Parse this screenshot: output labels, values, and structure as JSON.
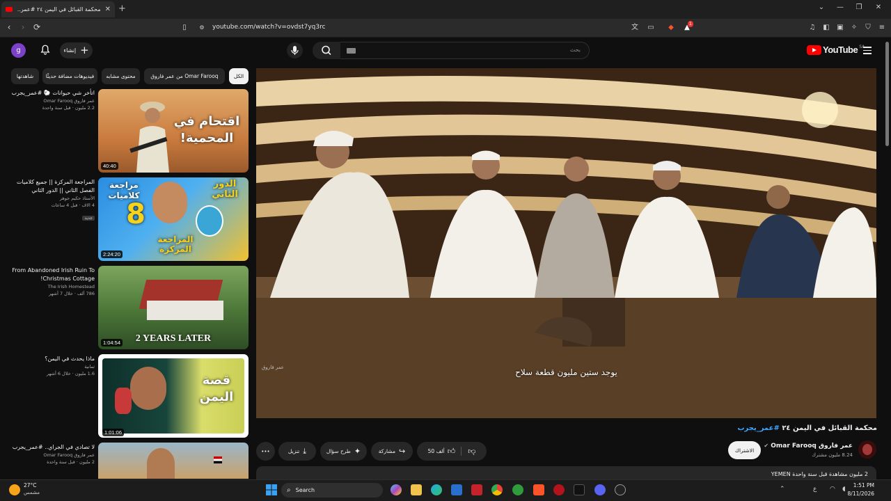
{
  "browser": {
    "tab_title": "محكمة القبائل في اليمن ٢٤ #عمر...",
    "url": "youtube.com/watch?v=ovdst7yq3rc",
    "badge_count": "1"
  },
  "header": {
    "avatar_letter": "g",
    "create_label": "إنشاء",
    "search_placeholder": "بحث",
    "logo_text": "YouTube",
    "logo_country": "SA"
  },
  "chips": [
    {
      "label": "الكل"
    },
    {
      "label": "من عمر فاروق Omar Farooq"
    },
    {
      "label": "محتوى مشابه"
    },
    {
      "label": "فيديوهات مضافة حديثًا"
    },
    {
      "label": "شاهدتها"
    }
  ],
  "recommendations": [
    {
      "title": "اتأخر شي حيوانات 🐑 #عمر_يجرب",
      "channel": "عمر فاروق Omar Farooq",
      "stats": "2.2 مليون · قبل سنة واحدة",
      "duration": "40:40",
      "thumb_text": "اقتحام في المحمية!"
    },
    {
      "title": "المراجعة المركزة || جميع كلاميات الفصل الثاني || الدور الثاني",
      "channel": "الأستاذ حكيم جوهر",
      "stats": "4 الاف · قبل 4 ساعات",
      "duration": "2:24:20",
      "badge": "جديد",
      "thumb_text_1": "الدور الثاني",
      "thumb_text_2": "مراجعة كلاميات",
      "thumb_text_3": "المراجعة المركزة",
      "thumb_number": "8"
    },
    {
      "title": "From Abandoned Irish Ruin To Christmas Cottage!",
      "channel": "The Irish Homestead",
      "stats": "786 ألف · خلال 7 أشهر",
      "duration": "1:04:54",
      "thumb_text": "2 YEARS LATER"
    },
    {
      "title": "ماذا يحدث في اليمن؟",
      "channel": "ثمانية",
      "stats": "1.6 مليون · خلال 6 أشهر",
      "duration": "1:01:06",
      "thumb_text": "قصة اليمن"
    },
    {
      "title": "لا تصادي في الجراي.. #عمر_يجرب",
      "channel": "عمر فاروق Omar Farooq",
      "stats": "2 مليون · قبل سنة واحدة",
      "duration": ""
    }
  ],
  "player": {
    "subtitle": "يوجد ستين مليون قطعة سلاح",
    "watermark": "عمر فاروق"
  },
  "video": {
    "title_text": "محكمة القبائل في اليمن ٢٤",
    "title_tag": "#عمر_يجرب",
    "channel_name": "عمر فاروق Omar Farooq",
    "subscribers": "8.24 مليون مشترك",
    "subscribe_label": "الاشتراك",
    "likes": "50 ألف",
    "share_label": "مشاركة",
    "ask_label": "طرح سؤال",
    "download_label": "تنزيل",
    "more_label": "•••",
    "description_line": "2 مليون مشاهدة قبل سنة واحدة  YEMEN"
  },
  "taskbar": {
    "weather_temp": "27°C",
    "weather_cond": "مشمس",
    "search_label": "Search",
    "time": "1:51 PM",
    "date": "8/11/2026"
  },
  "colors": {
    "background": "#0f0f0f",
    "accent_red": "#ff0000",
    "hashtag_blue": "#3ea6ff",
    "chip_bg": "#272727"
  }
}
